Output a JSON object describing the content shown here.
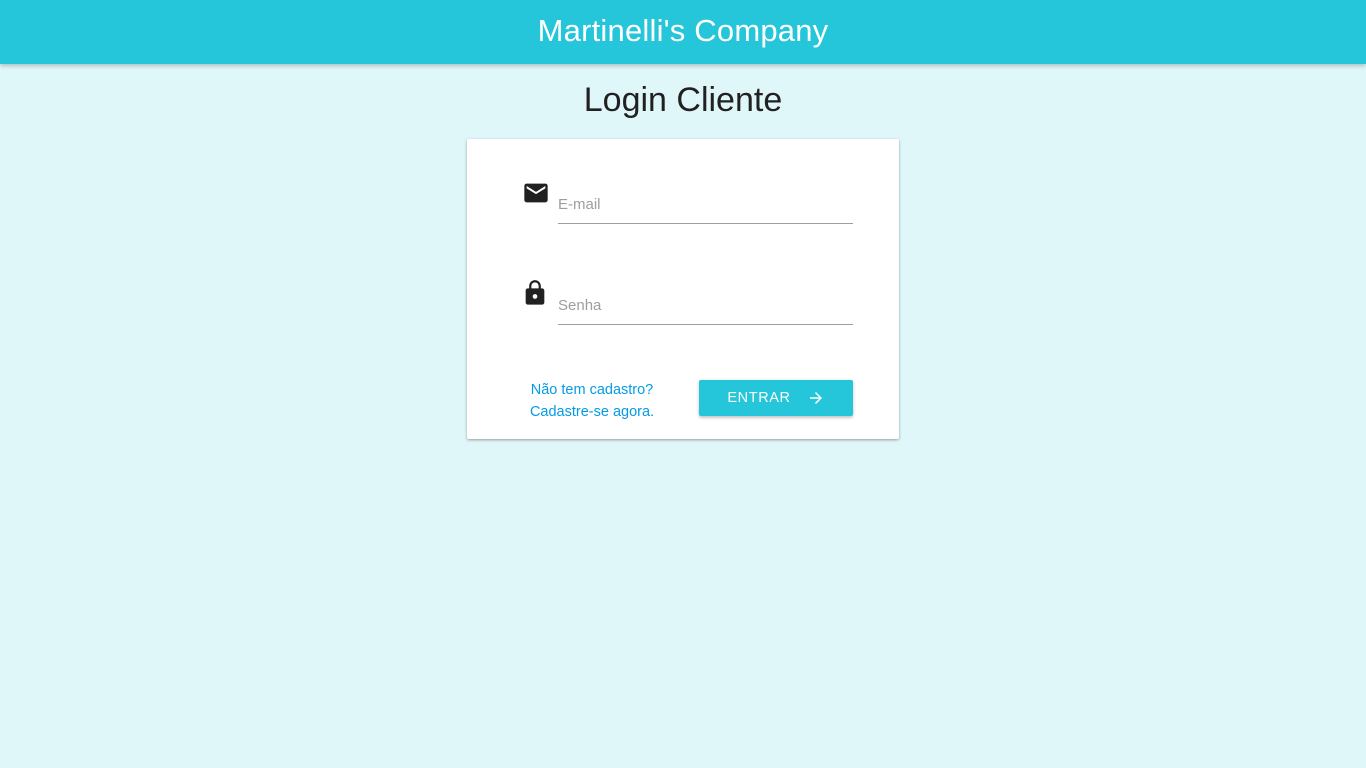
{
  "header": {
    "brand": "Martinelli's Company",
    "bar_color": "#26c6da"
  },
  "page": {
    "title": "Login Cliente",
    "background_color": "#e0f7fa"
  },
  "login_form": {
    "email": {
      "placeholder": "E-mail",
      "value": "",
      "icon": "email-icon"
    },
    "password": {
      "placeholder": "Senha",
      "value": "",
      "icon": "lock-icon"
    },
    "signup_link": {
      "line1": "Não tem cadastro?",
      "line2": "Cadastre-se agora.",
      "color": "#039be5"
    },
    "submit": {
      "label": "ENTRAR",
      "icon": "arrow-forward-icon",
      "color": "#26c6da"
    }
  }
}
